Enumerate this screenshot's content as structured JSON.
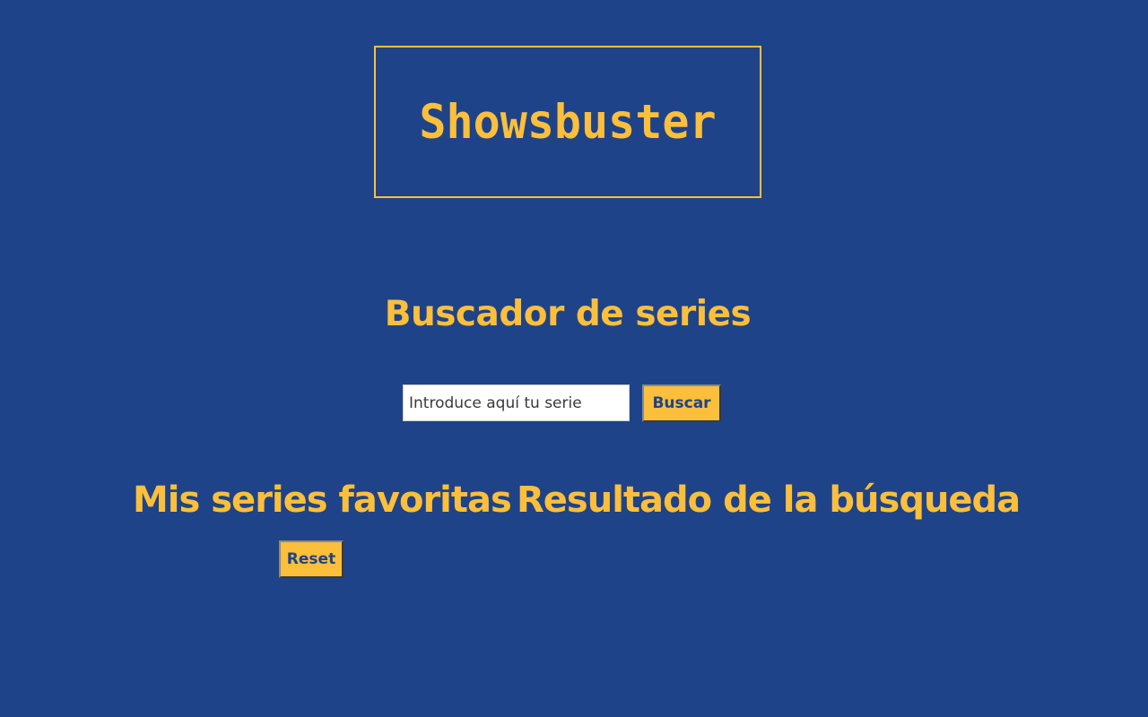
{
  "header": {
    "logo_text": "Showsbuster"
  },
  "search": {
    "title": "Buscador de series",
    "placeholder": "Introduce aquí tu serie",
    "value": "",
    "button_label": "Buscar"
  },
  "favorites": {
    "title": "Mis series favoritas",
    "reset_label": "Reset"
  },
  "results": {
    "title": "Resultado de la búsqueda"
  },
  "colors": {
    "background": "#1f4389",
    "accent": "#fbbf3b"
  }
}
